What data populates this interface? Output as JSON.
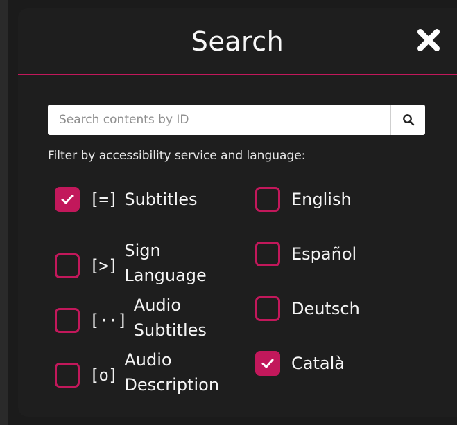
{
  "dialog": {
    "title": "Search",
    "close_icon": "close-x-icon"
  },
  "search": {
    "placeholder": "Search contents by ID",
    "value": "",
    "button_icon": "search-icon"
  },
  "filter_label": "Filter by accessibility service and language:",
  "services": [
    {
      "icon_text": "[=]",
      "label_line1": "Subtitles",
      "label_line2": "",
      "checked": true
    },
    {
      "icon_text": "[>]",
      "label_line1": "Sign",
      "label_line2": "Language",
      "checked": false
    },
    {
      "icon_text": "[··]",
      "label_line1": "Audio",
      "label_line2": "Subtitles",
      "checked": false
    },
    {
      "icon_text": "[o]",
      "label_line1": "Audio",
      "label_line2": "Description",
      "checked": false
    }
  ],
  "languages": [
    {
      "label": "English",
      "checked": false
    },
    {
      "label": "Español",
      "checked": false
    },
    {
      "label": "Deutsch",
      "checked": false
    },
    {
      "label": "Català",
      "checked": true
    }
  ],
  "colors": {
    "accent": "#c2185b",
    "panel": "#1e1e1e",
    "text": "#f5f5f5"
  }
}
